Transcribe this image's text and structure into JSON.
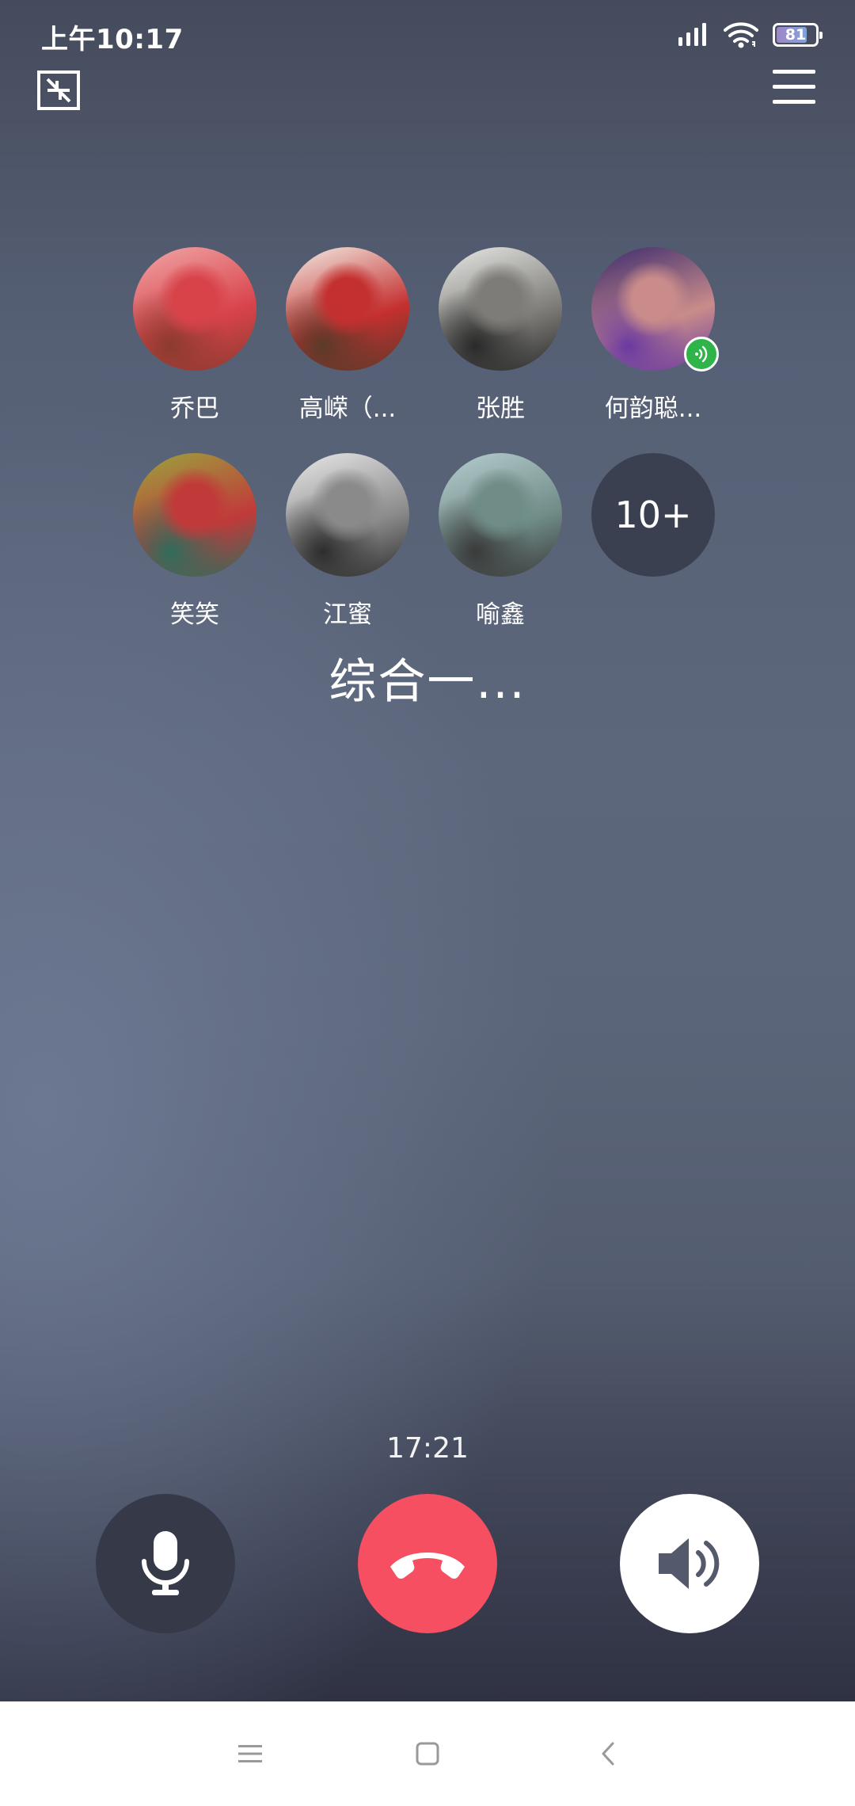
{
  "status_bar": {
    "time": "上午10:17",
    "battery_level": "81",
    "battery_fraction": 0.81,
    "icons": [
      "signal-icon",
      "wifi-icon",
      "battery-icon"
    ]
  },
  "toolbar": {
    "minimize_icon": "minimize-window-icon",
    "menu_icon": "menu-icon"
  },
  "participants": [
    {
      "name": "乔巴",
      "avatar_colors": [
        "#f1a7a8",
        "#d8434a",
        "#8b3b2f"
      ]
    },
    {
      "name": "高嵘（...",
      "avatar_colors": [
        "#f4eee6",
        "#c43030",
        "#5b3a2a"
      ]
    },
    {
      "name": "张胜",
      "avatar_colors": [
        "#e8e8e6",
        "#7d7c78",
        "#2a2a2a"
      ]
    },
    {
      "name": "何韵聪...",
      "avatar_colors": [
        "#3b2a6e",
        "#c98c8a",
        "#6a3aa0"
      ],
      "speaking": true
    },
    {
      "name": "笑笑",
      "avatar_colors": [
        "#9aa53c",
        "#c13a3a",
        "#2f6d5c"
      ]
    },
    {
      "name": "江蜜",
      "avatar_colors": [
        "#e9e9e9",
        "#8a8a8a",
        "#2d2d2d"
      ]
    },
    {
      "name": "喻鑫",
      "avatar_colors": [
        "#b7cdd0",
        "#6f8c87",
        "#3a3a3a"
      ]
    }
  ],
  "more_count": "10+",
  "group_title": "综合一...",
  "call_duration": "17:21",
  "controls": {
    "mic_icon": "microphone-icon",
    "hangup_icon": "hang-up-phone-icon",
    "speaker_icon": "speaker-icon",
    "hangup_color": "#f54f61"
  },
  "nav_bar": {
    "icons": [
      "recent-apps-icon",
      "home-icon",
      "back-icon"
    ]
  }
}
